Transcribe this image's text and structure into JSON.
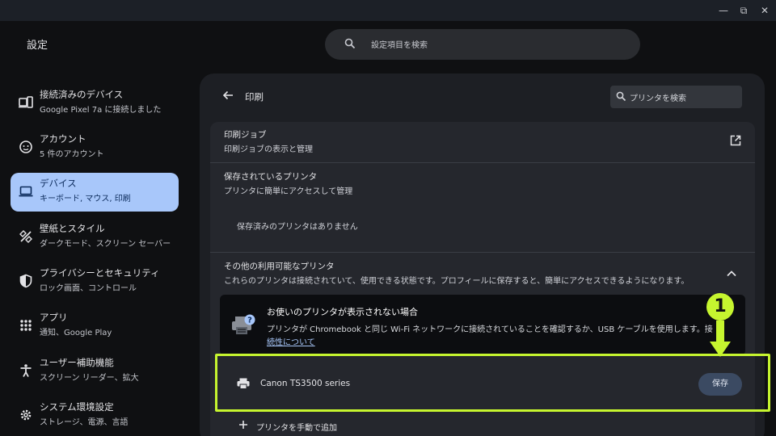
{
  "window": {
    "controls": {
      "minimize": "—",
      "maximize": "⧉",
      "close": "✕"
    }
  },
  "app": {
    "title": "設定"
  },
  "search": {
    "placeholder": "設定項目を検索"
  },
  "sidebar": {
    "items": [
      {
        "title": "接続済みのデバイス",
        "subtitle": "Google Pixel 7a に接続しました",
        "icon": "phone-laptop-icon",
        "active": false
      },
      {
        "title": "アカウント",
        "subtitle": "5 件のアカウント",
        "icon": "account-face-icon",
        "active": false
      },
      {
        "title": "デバイス",
        "subtitle": "キーボード, マウス, 印刷",
        "icon": "laptop-icon",
        "active": true
      },
      {
        "title": "壁紙とスタイル",
        "subtitle": "ダークモード、スクリーン セーバー",
        "icon": "paint-brush-icon",
        "active": false
      },
      {
        "title": "プライバシーとセキュリティ",
        "subtitle": "ロック画面、コントロール",
        "icon": "shield-icon",
        "active": false
      },
      {
        "title": "アプリ",
        "subtitle": "通知、Google Play",
        "icon": "apps-grid-icon",
        "active": false
      },
      {
        "title": "ユーザー補助機能",
        "subtitle": "スクリーン リーダー、拡大",
        "icon": "accessibility-icon",
        "active": false
      },
      {
        "title": "システム環境設定",
        "subtitle": "ストレージ、電源、言語",
        "icon": "gear-icon",
        "active": false
      }
    ]
  },
  "page": {
    "title": "印刷",
    "printer_search": {
      "placeholder": "プリンタを検索"
    },
    "print_jobs": {
      "title": "印刷ジョブ",
      "subtitle": "印刷ジョブの表示と管理"
    },
    "saved_printers": {
      "title": "保存されているプリンタ",
      "subtitle": "プリンタに簡単にアクセスして管理",
      "empty": "保存済みのプリンタはありません"
    },
    "available_printers": {
      "title": "その他の利用可能なプリンタ",
      "subtitle": "これらのプリンタは接続されていて、使用できる状態です。プロフィールに保存すると、簡単にアクセスできるようになります。"
    },
    "notice": {
      "title": "お使いのプリンタが表示されない場合",
      "body": "プリンタが Chromebook と同じ Wi-Fi ネットワークに接続されていることを確認するか、USB ケーブルを使用します。接",
      "link": "続性について"
    },
    "printer": {
      "name": "Canon TS3500 series",
      "save_label": "保存"
    },
    "add_manual": {
      "label": "プリンタを手動で追加",
      "icon": "+"
    }
  },
  "annotation": {
    "step": "1",
    "accent": "#c6f52f"
  }
}
